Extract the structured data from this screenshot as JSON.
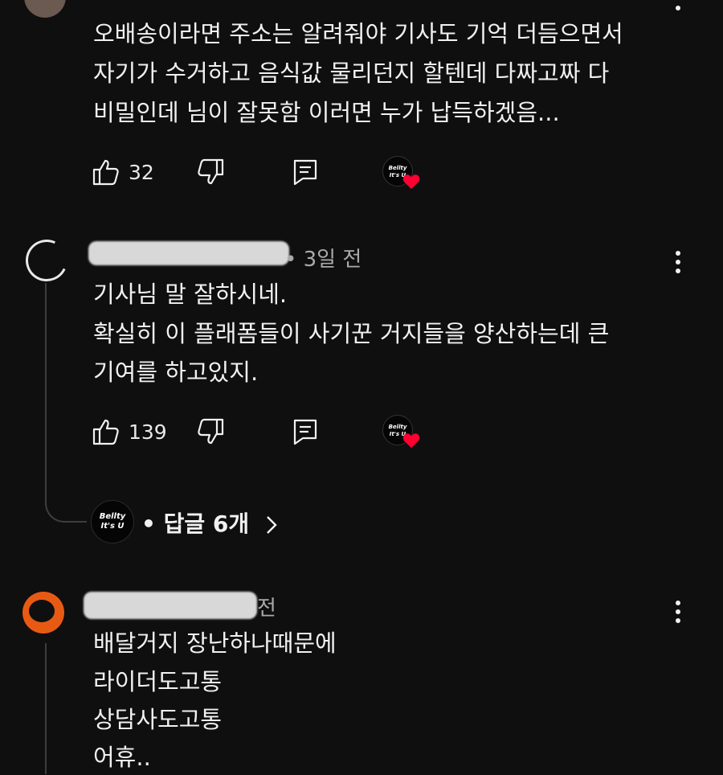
{
  "comments": [
    {
      "lines": [
        "오배송이라면 주소는 알려줘야 기사도 기억 더듬으면서",
        "자기가 수거하고 음식값 물리던지 할텐데 다짜고짜 다",
        "비밀인데 님이 잘못함 이러면 누가 납득하겠음..."
      ],
      "likes": "32",
      "creator_badge": "Bellty It's U"
    },
    {
      "time": "• 3일 전",
      "lines": [
        "기사님 말 잘하시네.",
        "확실히 이 플래폼들이 사기꾼 거지들을 양산하는데 큰",
        "기여를 하고있지."
      ],
      "likes": "139",
      "creator_badge": "Bellty It's U",
      "replies_label": "• 답글 6개",
      "replies_avatar": "Bellty It's U"
    },
    {
      "time": "전",
      "lines": [
        "배달거지 장난하나때문에",
        "라이더도고통",
        "상담사도고통",
        "어휴.."
      ]
    }
  ],
  "colors": {
    "background": "#0f0f0f",
    "text": "#f1f1f1",
    "meta": "#aaaaaa",
    "heart": "#ff0033",
    "avatar_orange": "#e85a14"
  },
  "icons": [
    "like-icon",
    "dislike-icon",
    "reply-icon",
    "more-icon",
    "heart-icon",
    "chevron-right-icon"
  ]
}
